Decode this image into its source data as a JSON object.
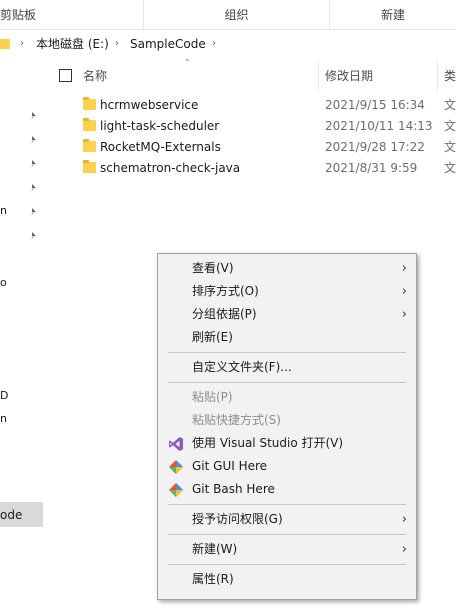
{
  "ribbon": {
    "groups": [
      "剪贴板",
      "组织",
      "新建"
    ]
  },
  "address": {
    "drive": "本地磁盘 (E:)",
    "folder": "SampleCode"
  },
  "columns": {
    "name": "名称",
    "modified": "修改日期",
    "type": "类"
  },
  "files": [
    {
      "name": "hcrmwebservice",
      "modified": "2021/9/15 16:34",
      "type": "文"
    },
    {
      "name": "light-task-scheduler",
      "modified": "2021/10/11 14:13",
      "type": "文"
    },
    {
      "name": "RocketMQ-Externals",
      "modified": "2021/9/28 17:22",
      "type": "文"
    },
    {
      "name": "schematron-check-java",
      "modified": "2021/8/31 9:59",
      "type": "文"
    }
  ],
  "nav": {
    "cut_labels": [
      "n",
      "o",
      "D",
      "n"
    ],
    "selected": "ode"
  },
  "context_menu": {
    "view": "查看(V)",
    "sort": "排序方式(O)",
    "group": "分组依据(P)",
    "refresh": "刷新(E)",
    "customize": "自定义文件夹(F)...",
    "paste": "粘贴(P)",
    "paste_shortcut": "粘贴快捷方式(S)",
    "open_vs": "使用 Visual Studio 打开(V)",
    "git_gui": "Git GUI Here",
    "git_bash": "Git Bash Here",
    "grant_access": "授予访问权限(G)",
    "new": "新建(W)",
    "properties": "属性(R)"
  },
  "colors": {
    "folder": "#ffd24d",
    "vs_purple": "#865fc5",
    "menu_bg": "#f2f2f2"
  },
  "icons": {
    "submenu_arrow": "chevron-right-icon",
    "vs": "visual-studio-icon",
    "git": "git-icon",
    "pin": "pin-icon"
  }
}
